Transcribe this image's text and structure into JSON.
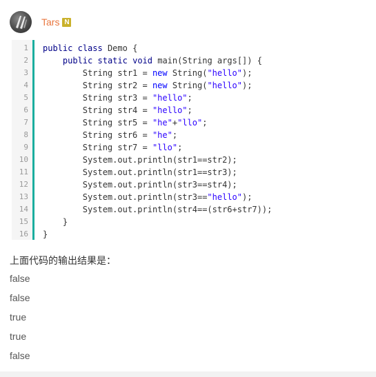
{
  "header": {
    "username": "Tars",
    "badge": "N"
  },
  "code": {
    "lines": [
      {
        "num": "1",
        "tokens": [
          {
            "t": "kw2",
            "v": "public"
          },
          {
            "t": "p",
            "v": " "
          },
          {
            "t": "kw2",
            "v": "class"
          },
          {
            "t": "p",
            "v": " Demo {"
          }
        ]
      },
      {
        "num": "2",
        "tokens": [
          {
            "t": "p",
            "v": "    "
          },
          {
            "t": "kw2",
            "v": "public"
          },
          {
            "t": "p",
            "v": " "
          },
          {
            "t": "kw2",
            "v": "static"
          },
          {
            "t": "p",
            "v": " "
          },
          {
            "t": "kw2",
            "v": "void"
          },
          {
            "t": "p",
            "v": " main(String args[]) {"
          }
        ]
      },
      {
        "num": "3",
        "tokens": [
          {
            "t": "p",
            "v": "        String str1 = "
          },
          {
            "t": "kw",
            "v": "new"
          },
          {
            "t": "p",
            "v": " String("
          },
          {
            "t": "str",
            "v": "\"hello\""
          },
          {
            "t": "p",
            "v": ");"
          }
        ]
      },
      {
        "num": "4",
        "tokens": [
          {
            "t": "p",
            "v": "        String str2 = "
          },
          {
            "t": "kw",
            "v": "new"
          },
          {
            "t": "p",
            "v": " String("
          },
          {
            "t": "str",
            "v": "\"hello\""
          },
          {
            "t": "p",
            "v": ");"
          }
        ]
      },
      {
        "num": "5",
        "tokens": [
          {
            "t": "p",
            "v": "        String str3 = "
          },
          {
            "t": "str",
            "v": "\"hello\""
          },
          {
            "t": "p",
            "v": ";"
          }
        ]
      },
      {
        "num": "6",
        "tokens": [
          {
            "t": "p",
            "v": "        String str4 = "
          },
          {
            "t": "str",
            "v": "\"hello\""
          },
          {
            "t": "p",
            "v": ";"
          }
        ]
      },
      {
        "num": "7",
        "tokens": [
          {
            "t": "p",
            "v": "        String str5 = "
          },
          {
            "t": "str",
            "v": "\"he\""
          },
          {
            "t": "p",
            "v": "+"
          },
          {
            "t": "str",
            "v": "\"llo\""
          },
          {
            "t": "p",
            "v": ";"
          }
        ]
      },
      {
        "num": "8",
        "tokens": [
          {
            "t": "p",
            "v": "        String str6 = "
          },
          {
            "t": "str",
            "v": "\"he\""
          },
          {
            "t": "p",
            "v": ";"
          }
        ]
      },
      {
        "num": "9",
        "tokens": [
          {
            "t": "p",
            "v": "        String str7 = "
          },
          {
            "t": "str",
            "v": "\"llo\""
          },
          {
            "t": "p",
            "v": ";"
          }
        ]
      },
      {
        "num": "10",
        "tokens": [
          {
            "t": "p",
            "v": "        System.out.println(str1==str2);"
          }
        ]
      },
      {
        "num": "11",
        "tokens": [
          {
            "t": "p",
            "v": "        System.out.println(str1==str3);"
          }
        ]
      },
      {
        "num": "12",
        "tokens": [
          {
            "t": "p",
            "v": "        System.out.println(str3==str4);"
          }
        ]
      },
      {
        "num": "13",
        "tokens": [
          {
            "t": "p",
            "v": "        System.out.println(str3=="
          },
          {
            "t": "str",
            "v": "\"hello\""
          },
          {
            "t": "p",
            "v": ");"
          }
        ]
      },
      {
        "num": "14",
        "tokens": [
          {
            "t": "p",
            "v": "        System.out.println(str4==(str6+str7));"
          }
        ]
      },
      {
        "num": "15",
        "tokens": [
          {
            "t": "p",
            "v": "    }"
          }
        ]
      },
      {
        "num": "16",
        "tokens": [
          {
            "t": "p",
            "v": "}"
          }
        ]
      }
    ]
  },
  "question": "上面代码的输出结果是：",
  "options": [
    "false",
    "false",
    "true",
    "true",
    "false"
  ],
  "colors": {
    "username": "#e9763e",
    "badge": "#c9b12b",
    "gutter_accent": "#1aae9f",
    "keyword": "#000088",
    "string": "#2a00ff"
  }
}
